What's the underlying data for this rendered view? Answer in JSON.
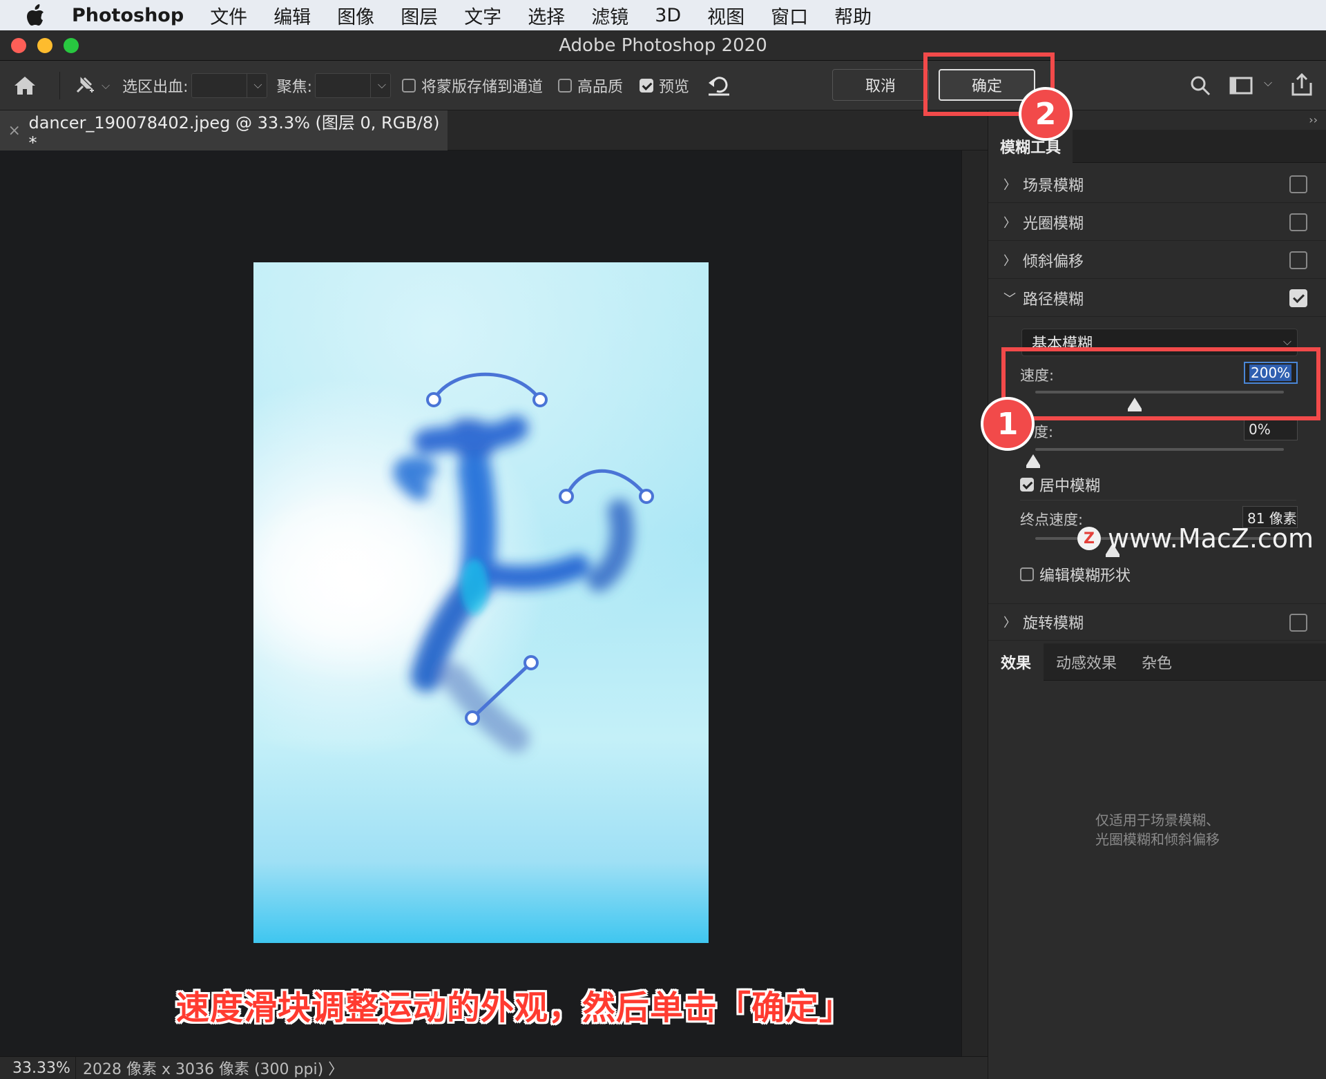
{
  "menubar": {
    "app_name": "Photoshop",
    "items": [
      "文件",
      "编辑",
      "图像",
      "图层",
      "文字",
      "选择",
      "滤镜",
      "3D",
      "视图",
      "窗口",
      "帮助"
    ]
  },
  "window": {
    "title": "Adobe Photoshop 2020"
  },
  "options_bar": {
    "selection_bleed_label": "选区出血:",
    "focus_label": "聚焦:",
    "save_mask_label": "将蒙版存储到通道",
    "save_mask_checked": false,
    "high_quality_label": "高品质",
    "high_quality_checked": false,
    "preview_label": "预览",
    "preview_checked": true,
    "cancel_label": "取消",
    "ok_label": "确定"
  },
  "document": {
    "tab_title": "dancer_190078402.jpeg @ 33.3% (图层 0, RGB/8) *"
  },
  "status": {
    "zoom": "33.33%",
    "doc_size": "2028 像素 x 3036 像素 (300 ppi) 〉"
  },
  "panel": {
    "tab": "模糊工具",
    "blurs": [
      {
        "label": "场景模糊",
        "expanded": false,
        "checked": false
      },
      {
        "label": "光圈模糊",
        "expanded": false,
        "checked": false
      },
      {
        "label": "倾斜偏移",
        "expanded": false,
        "checked": false
      },
      {
        "label": "路径模糊",
        "expanded": true,
        "checked": true
      },
      {
        "label": "旋转模糊",
        "expanded": false,
        "checked": false
      }
    ],
    "path_blur": {
      "mode": "基本模糊",
      "speed_label": "速度:",
      "speed_value": "200%",
      "taper_label": "度:",
      "taper_value": "0%",
      "centered_label": "居中模糊",
      "centered_checked": true,
      "end_speed_label": "终点速度:",
      "end_speed_value": "81 像素",
      "edit_shapes_label": "编辑模糊形状",
      "edit_shapes_checked": false
    },
    "effects_tabs": [
      "效果",
      "动感效果",
      "杂色"
    ],
    "effects_message_line1": "仅适用于场景模糊、",
    "effects_message_line2": "光圈模糊和倾斜偏移"
  },
  "annotations": {
    "badge_1": "1",
    "badge_2": "2",
    "caption": "速度滑块调整运动的外观，然后单击「确定」",
    "watermark": "www.MacZ.com",
    "watermark_logo": "Z"
  },
  "colors": {
    "highlight": "#f24a4a",
    "accent_selection": "#2f5fb0"
  }
}
